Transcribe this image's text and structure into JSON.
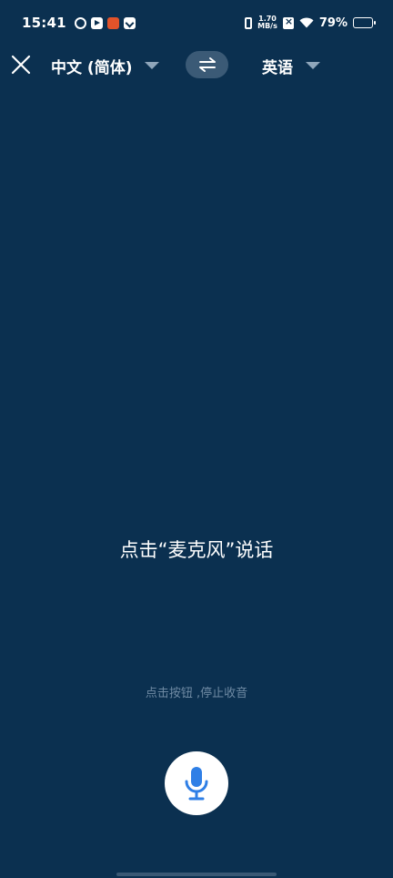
{
  "status_bar": {
    "time": "15:41",
    "speed_top": "1.70",
    "speed_bottom": "MB/s",
    "battery": "79%"
  },
  "toolbar": {
    "close_icon": "close-icon",
    "source_language": "中文 (简体)",
    "swap_icon": "swap-arrows-icon",
    "target_language": "英语"
  },
  "main": {
    "prompt": "点击“麦克风”说话",
    "hint": "点击按钮 ,停止收音"
  },
  "mic": {
    "icon": "microphone-icon"
  },
  "colors": {
    "background": "#0b3050",
    "swap_pill": "#3b5a76",
    "mic_accent": "#2f7fe6",
    "hint_text": "#6f8aa3"
  }
}
